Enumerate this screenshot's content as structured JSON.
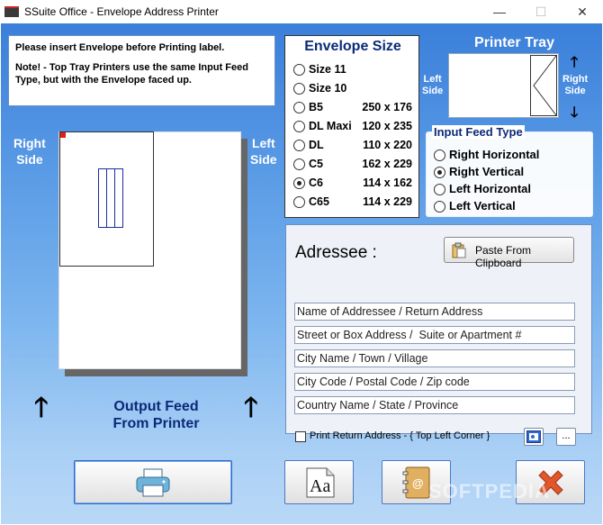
{
  "window": {
    "title": "SSuite Office - Envelope Address Printer",
    "minimize_glyph": "—",
    "maximize_glyph": "☐",
    "close_glyph": "✕"
  },
  "notice": {
    "line1": "Please insert Envelope before Printing label.",
    "line2": "Note!  -  Top Tray Printers use the same Input Feed Type, but  with the Envelope faced up."
  },
  "envelope_size": {
    "heading": "Envelope Size",
    "options": [
      {
        "name": "Size 11",
        "dims": "",
        "selected": false
      },
      {
        "name": "Size 10",
        "dims": "",
        "selected": false
      },
      {
        "name": "B5",
        "dims": "250 x 176",
        "selected": false
      },
      {
        "name": "DL Maxi",
        "dims": "120 x 235",
        "selected": false
      },
      {
        "name": "DL",
        "dims": "110 x 220",
        "selected": false
      },
      {
        "name": "C5",
        "dims": "162 x 229",
        "selected": false
      },
      {
        "name": "C6",
        "dims": "114 x 162",
        "selected": true
      },
      {
        "name": "C65",
        "dims": "114 x 229",
        "selected": false
      }
    ]
  },
  "printer_tray": {
    "heading": "Printer Tray",
    "left_label_1": "Left",
    "left_label_2": "Side",
    "right_label_1": "Right",
    "right_label_2": "Side",
    "up_arrow": "🡑",
    "down_arrow": "🡓"
  },
  "input_feed": {
    "legend": "Input Feed Type",
    "options": [
      {
        "name": "Right Horizontal",
        "selected": false
      },
      {
        "name": "Right Vertical",
        "selected": true
      },
      {
        "name": "Left Horizontal",
        "selected": false
      },
      {
        "name": "Left Vertical",
        "selected": false
      }
    ]
  },
  "preview": {
    "right_side_1": "Right",
    "right_side_2": "Side",
    "left_side_1": "Left",
    "left_side_2": "Side",
    "arrow": "🡑",
    "output_feed_1": "Output Feed",
    "output_feed_2": "From Printer"
  },
  "addressee": {
    "heading": "Adressee :",
    "paste_button": "Paste From Clipboard",
    "fields": [
      {
        "placeholder": "Name of Addressee / Return Address"
      },
      {
        "placeholder": "Street or Box Address /  Suite or Apartment #"
      },
      {
        "placeholder": "City Name / Town / Village"
      },
      {
        "placeholder": "City Code / Postal Code / Zip code"
      },
      {
        "placeholder": "Country Name / State / Province"
      }
    ],
    "return_checkbox_label": "Print Return Address - { Top Left Corner }",
    "return_checked": false,
    "more_button": "..."
  },
  "toolbar": {
    "buttons": [
      "print-button",
      "font-button",
      "address-book-button",
      "exit-button"
    ]
  },
  "watermark": "SOFTPEDIA",
  "colors": {
    "background_top": "#3a7fda",
    "background_bottom": "#b9d8f7",
    "heading_blue": "#0b2a78",
    "exit_red": "#e2572a"
  }
}
